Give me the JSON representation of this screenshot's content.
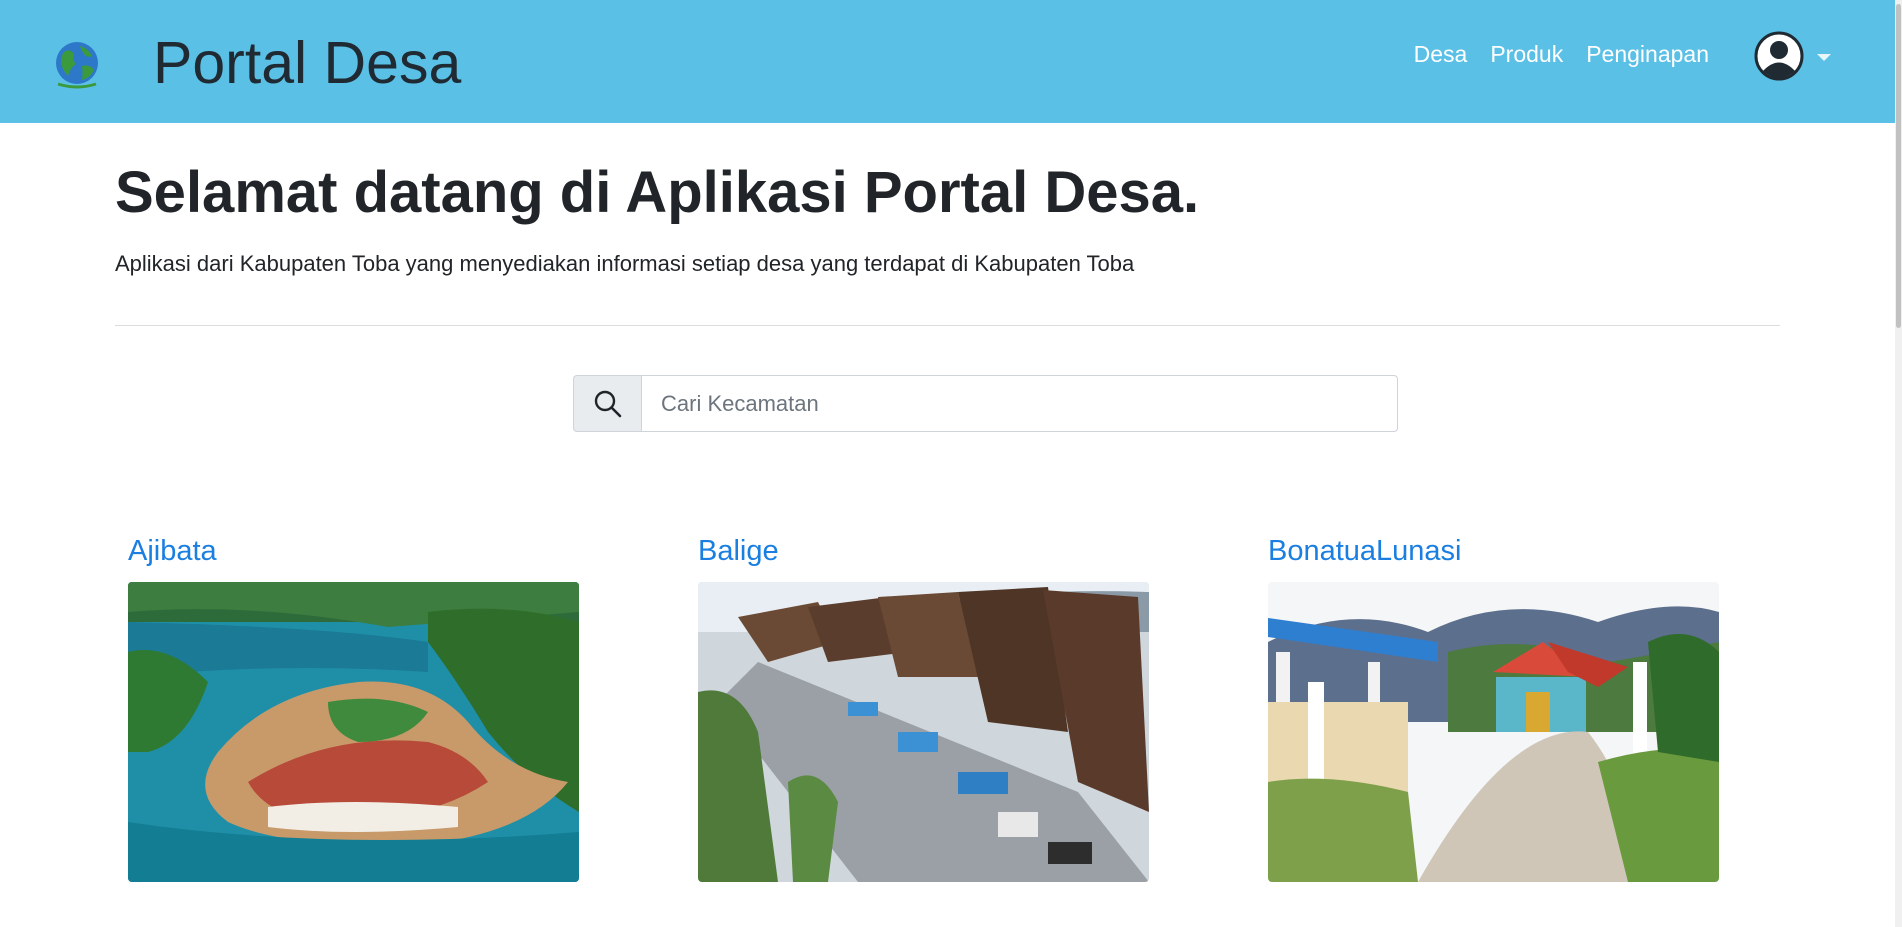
{
  "navbar": {
    "brand_title": "Portal Desa",
    "logo_icon": "globe-icon",
    "links": [
      {
        "label": "Desa"
      },
      {
        "label": "Produk"
      },
      {
        "label": "Penginapan"
      }
    ],
    "user_icon": "user-circle-icon",
    "accent": "#5bc0e6"
  },
  "hero": {
    "title": "Selamat datang di Aplikasi Portal Desa.",
    "lead": "Aplikasi dari Kabupaten Toba yang menyediakan informasi setiap desa yang terdapat di Kabupaten Toba"
  },
  "search": {
    "icon": "search-icon",
    "placeholder": "Cari Kecamatan",
    "value": ""
  },
  "cards": [
    {
      "title": "Ajibata",
      "image": "lake-peninsula-photo"
    },
    {
      "title": "Balige",
      "image": "traditional-market-photo"
    },
    {
      "title": "BonatuaLunasi",
      "image": "village-church-photo"
    }
  ],
  "colors": {
    "link": "#1a7fe0",
    "heading": "#212529"
  }
}
